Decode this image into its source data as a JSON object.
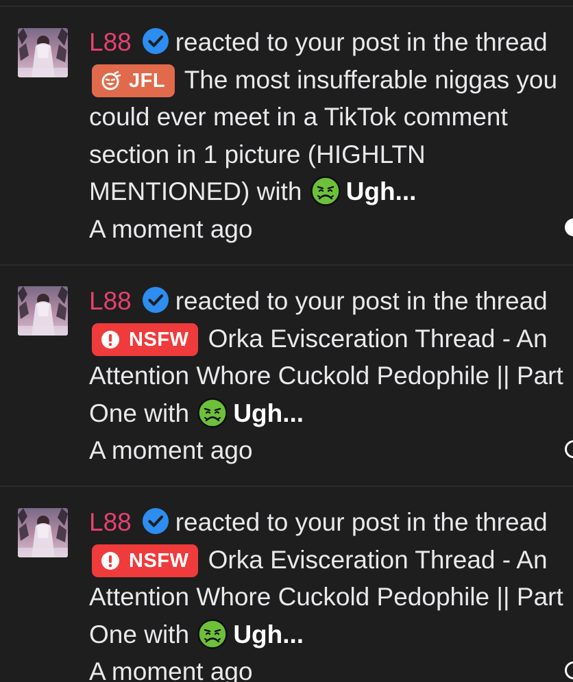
{
  "notifications": [
    {
      "username": "L88",
      "verified_icon": "verified-check-icon",
      "action": "reacted to your post in the thread",
      "prefix": {
        "label": "JFL",
        "icon": "laughing-face-icon",
        "color": "#e06a4b"
      },
      "thread_title": "The most insufferable niggas you could ever meet in a TikTok comment section in 1 picture (HIGHLTN MENTIONED)",
      "with_text": "with",
      "reaction_icon": "nauseated-face-emoji",
      "reaction": "Ugh...",
      "time": "A moment ago",
      "read_state": "unread"
    },
    {
      "username": "L88",
      "verified_icon": "verified-check-icon",
      "action": "reacted to your post in the thread",
      "prefix": {
        "label": "NSFW",
        "icon": "alert-icon",
        "color": "#ef3b3b"
      },
      "thread_title": "Orka Evisceration Thread - An Attention Whore Cuckold Pedophile || Part One",
      "with_text": "with",
      "reaction_icon": "nauseated-face-emoji",
      "reaction": "Ugh...",
      "time": "A moment ago",
      "read_state": "read"
    },
    {
      "username": "L88",
      "verified_icon": "verified-check-icon",
      "action": "reacted to your post in the thread",
      "prefix": {
        "label": "NSFW",
        "icon": "alert-icon",
        "color": "#ef3b3b"
      },
      "thread_title": "Orka Evisceration Thread - An Attention Whore Cuckold Pedophile || Part One",
      "with_text": "with",
      "reaction_icon": "nauseated-face-emoji",
      "reaction": "Ugh...",
      "time": "A moment ago",
      "read_state": "read"
    }
  ],
  "colors": {
    "background": "#1e1e1f",
    "username": "#e8416e",
    "verified": "#2d8df0",
    "text": "#e9e9ec"
  }
}
